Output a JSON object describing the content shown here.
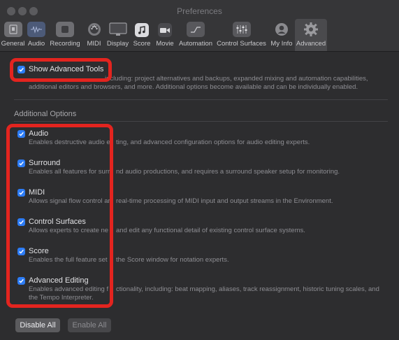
{
  "window": {
    "title": "Preferences"
  },
  "toolbar": {
    "items": [
      {
        "label": "General",
        "icon": "general-icon"
      },
      {
        "label": "Audio",
        "icon": "audio-icon"
      },
      {
        "label": "Recording",
        "icon": "recording-icon"
      },
      {
        "label": "MIDI",
        "icon": "midi-icon"
      },
      {
        "label": "Display",
        "icon": "display-icon"
      },
      {
        "label": "Score",
        "icon": "score-icon"
      },
      {
        "label": "Movie",
        "icon": "movie-icon"
      },
      {
        "label": "Automation",
        "icon": "automation-icon"
      },
      {
        "label": "Control Surfaces",
        "icon": "control-surfaces-icon"
      },
      {
        "label": "My Info",
        "icon": "my-info-icon"
      },
      {
        "label": "Advanced",
        "icon": "advanced-gear-icon",
        "selected": true
      }
    ]
  },
  "advanced_tools": {
    "label": "Show Advanced Tools",
    "checked": true,
    "description_line1": "including: project alternatives and backups, expanded mixing and automation capabilities,",
    "description_line2": "additional editors and browsers, and more. Additional options become available and can be individually enabled."
  },
  "additional_options": {
    "heading": "Additional Options",
    "options": [
      {
        "label": "Audio",
        "checked": true,
        "desc_left": "Enables destructive audio e",
        "desc_right": "ting, and advanced configuration options for audio editing experts."
      },
      {
        "label": "Surround",
        "checked": true,
        "desc_left": "Enables all features for surr",
        "desc_right": "nd audio productions, and requires a surround speaker setup for monitoring."
      },
      {
        "label": "MIDI",
        "checked": true,
        "desc_left": "Allows signal flow control ar",
        "desc_right": "real-time processing of MIDI input and output streams in the Environment."
      },
      {
        "label": "Control Surfaces",
        "checked": true,
        "desc_left": "Allows experts to create ne",
        "desc_right": "and edit any functional detail of existing control surface systems."
      },
      {
        "label": "Score",
        "checked": true,
        "desc_left": "Enables the full feature set",
        "desc_right": "the Score window for notation experts."
      },
      {
        "label": "Advanced Editing",
        "checked": true,
        "desc_left": "Enables advanced editing f",
        "desc_right": "ctionality, including: beat mapping, aliases, track reassignment, historic tuning scales, and",
        "desc_line2": "the Tempo Interpreter."
      }
    ]
  },
  "buttons": {
    "disable_all": "Disable All",
    "enable_all": "Enable All"
  },
  "colors": {
    "accent": "#2c7cf6",
    "highlight_box": "#e3241f",
    "background": "#2d2d2f"
  }
}
